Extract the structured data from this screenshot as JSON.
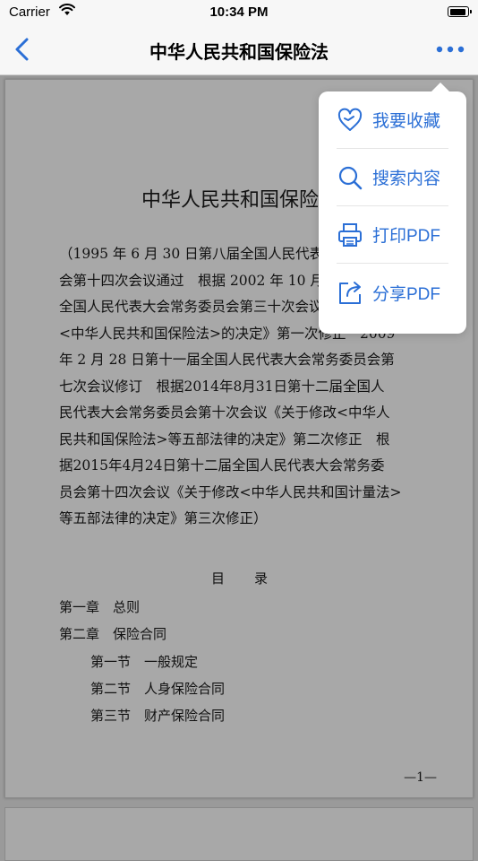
{
  "status_bar": {
    "carrier": "Carrier",
    "time": "10:34 PM",
    "battery_level": 0.95
  },
  "nav": {
    "title": "中华人民共和国保险法",
    "accent_color": "#2b6fd6"
  },
  "document": {
    "title": "中华人民共和国保险法",
    "intro_lines": [
      "（1995 年 6 月 30 日第八届全国人民代表大会常务委员",
      "会第十四次会议通过　根据 2002 年 10 月 28 日第九届",
      "全国人民代表大会常务委员会第三十次会议《关于修改",
      "<中华人民共和国保险法>的决定》第一次修正　2009",
      "年 2 月 28 日第十一届全国人民代表大会常务委员会第",
      "七次会议修订　根据2014年8月31日第十二届全国人",
      "民代表大会常务委员会第十次会议《关于修改<中华人",
      "民共和国保险法>等五部法律的决定》第二次修正　根",
      "据2015年4月24日第十二届全国人民代表大会常务委",
      "员会第十四次会议《关于修改<中华人民共和国计量法>",
      "等五部法律的决定》第三次修正）"
    ],
    "toc_heading": "目　　录",
    "toc": [
      {
        "number": "第一章",
        "title": "总则"
      },
      {
        "number": "第二章",
        "title": "保险合同"
      },
      {
        "number": "第一节",
        "title": "一般规定"
      },
      {
        "number": "第二节",
        "title": "人身保险合同"
      },
      {
        "number": "第三节",
        "title": "财产保险合同"
      }
    ],
    "page_number": "—1—"
  },
  "menu": {
    "items": [
      {
        "label": "我要收藏",
        "icon": "heart-icon"
      },
      {
        "label": "搜索内容",
        "icon": "search-icon"
      },
      {
        "label": "打印PDF",
        "icon": "printer-icon"
      },
      {
        "label": "分享PDF",
        "icon": "share-icon"
      }
    ]
  }
}
